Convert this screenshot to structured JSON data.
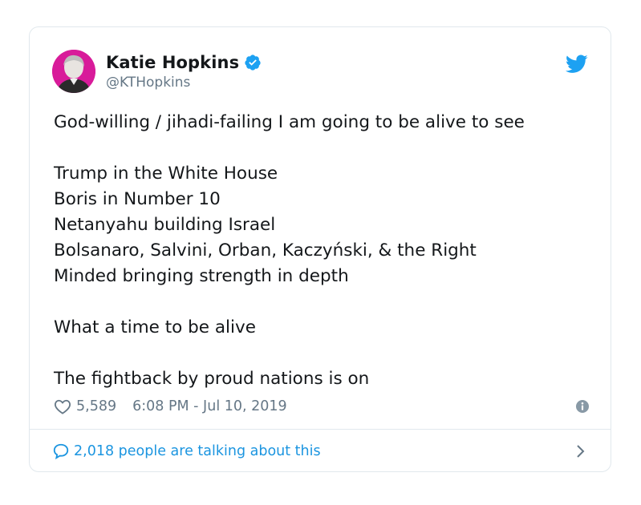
{
  "tweet": {
    "author": {
      "display_name": "Katie Hopkins",
      "handle": "@KTHopkins",
      "verified": true,
      "avatar_bg": "#d81b9a"
    },
    "text": {
      "line1": "God-willing / jihadi-failing I am going to be alive to see",
      "line2": "Trump in the White House",
      "line3": "Boris in Number 10",
      "line4": "Netanyahu building Israel",
      "line5": "Bolsanaro, Salvini, Orban, Kaczyński, & the Right",
      "line6": "Minded bringing strength in depth",
      "line7": "What a time to be alive",
      "line8": "The fightback by proud nations is on"
    },
    "likes": "5,589",
    "timestamp": "6:08 PM - Jul 10, 2019",
    "footer_text": "2,018 people are talking about this"
  },
  "icons": {
    "verified": "verified-badge-icon",
    "logo": "twitter-bird-icon",
    "like": "heart-icon",
    "info": "info-icon",
    "talking": "speech-bubble-icon",
    "more": "chevron-right-icon"
  },
  "colors": {
    "twitter_blue": "#1da1f2",
    "link_blue": "#1b95e0",
    "secondary_text": "#657786",
    "border": "#e1e8ed"
  }
}
